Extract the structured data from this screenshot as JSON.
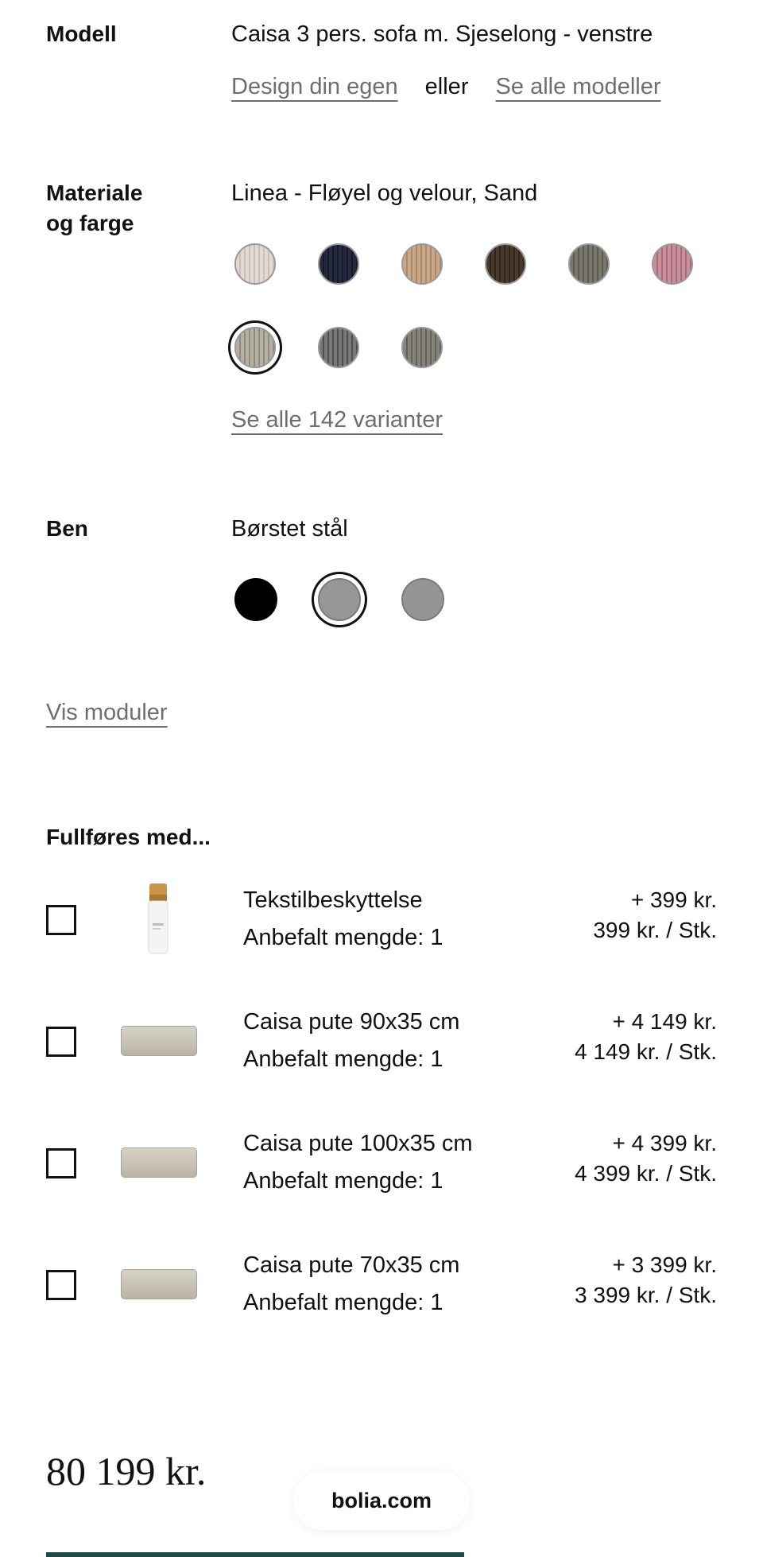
{
  "model": {
    "label": "Modell",
    "value": "Caisa 3 pers. sofa m. Sjeselong - venstre",
    "design_link": "Design din egen",
    "or_text": "eller",
    "all_models_link": "Se alle modeller"
  },
  "material": {
    "label_line1": "Materiale",
    "label_line2": "og farge",
    "value": "Linea - Fløyel og velour, Sand",
    "swatches": [
      {
        "name": "cream",
        "color": "#e2dad2",
        "stripe": "#cbbfb4"
      },
      {
        "name": "navy",
        "color": "#262a3e",
        "stripe": "#151826"
      },
      {
        "name": "camel",
        "color": "#c9a98a",
        "stripe": "#a98767"
      },
      {
        "name": "brown",
        "color": "#4a3a2b",
        "stripe": "#2f2418"
      },
      {
        "name": "olive-grey",
        "color": "#7a786c",
        "stripe": "#5c5a50"
      },
      {
        "name": "rose",
        "color": "#c8909c",
        "stripe": "#a86e7a"
      },
      {
        "name": "sand",
        "color": "#b4b0a4",
        "stripe": "#8f8b7f",
        "selected": true
      },
      {
        "name": "dark-grey",
        "color": "#77787a",
        "stripe": "#4e4f52"
      },
      {
        "name": "taupe",
        "color": "#85837a",
        "stripe": "#626058"
      }
    ],
    "all_variants_link": "Se alle 142 varianter"
  },
  "legs": {
    "label": "Ben",
    "value": "Børstet stål",
    "options": [
      {
        "name": "black",
        "color": "#000000"
      },
      {
        "name": "brushed-steel",
        "color": "#979797",
        "selected": true
      },
      {
        "name": "grey",
        "color": "#959595"
      }
    ]
  },
  "modules_link": "Vis moduler",
  "addons": {
    "title": "Fullføres med...",
    "items": [
      {
        "name": "Tekstilbeskyttelse",
        "qty": "Anbefalt mengde: 1",
        "price": "+ 399 kr.",
        "unit": "399 kr. / Stk.",
        "thumb": "bottle"
      },
      {
        "name": "Caisa pute 90x35 cm",
        "qty": "Anbefalt mengde: 1",
        "price": "+ 4 149 kr.",
        "unit": "4 149 kr. / Stk.",
        "thumb": "cushion"
      },
      {
        "name": "Caisa pute 100x35 cm",
        "qty": "Anbefalt mengde: 1",
        "price": "+ 4 399 kr.",
        "unit": "4 399 kr. / Stk.",
        "thumb": "cushion"
      },
      {
        "name": "Caisa pute 70x35 cm",
        "qty": "Anbefalt mengde: 1",
        "price": "+ 3 399 kr.",
        "unit": "3 399 kr. / Stk.",
        "thumb": "cushion"
      }
    ]
  },
  "total_price": "80 199 kr.",
  "url_text": "bolia.com",
  "colors": {
    "cta": "#1f4a45"
  }
}
